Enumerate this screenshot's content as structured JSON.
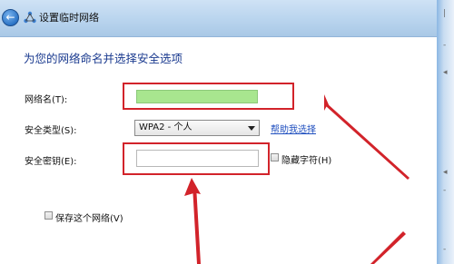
{
  "window": {
    "title": "设置临时网络",
    "back_icon": "back-arrow-icon",
    "app_icon": "network-icon"
  },
  "page": {
    "heading": "为您的网络命名并选择安全选项"
  },
  "form": {
    "network_name": {
      "label": "网络名(T):",
      "value": ""
    },
    "security_type": {
      "label": "安全类型(S):",
      "selected": "WPA2 - 个人",
      "help_link": "帮助我选择"
    },
    "security_key": {
      "label": "安全密钥(E):",
      "value": "",
      "hide_chars_label": "隐藏字符(H)"
    },
    "save_network_label": "保存这个网络(V)"
  },
  "colors": {
    "annotation": "#d2232a",
    "name_field_fill": "#a8e68f",
    "heading": "#1a3a8f"
  }
}
